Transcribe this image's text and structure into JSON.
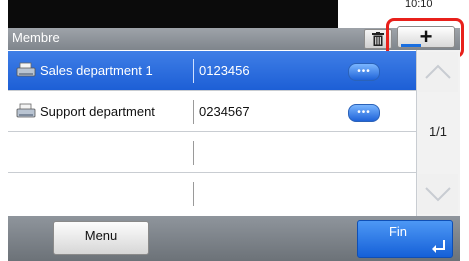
{
  "status": {
    "time": "10:10"
  },
  "header": {
    "title": "Membre"
  },
  "toolbar": {
    "add_label": "+"
  },
  "rows": [
    {
      "name": "Sales department 1",
      "number": "0123456",
      "selected": true,
      "icon": "fax-printer-icon"
    },
    {
      "name": "Support department",
      "number": "0234567",
      "selected": false,
      "icon": "fax-printer-icon"
    }
  ],
  "pagination": {
    "indicator": "1/1"
  },
  "bottom": {
    "menu_label": "Menu",
    "fin_label": "Fin"
  },
  "colors": {
    "accent": "#1d5fd6",
    "highlight": "#e8201b"
  }
}
